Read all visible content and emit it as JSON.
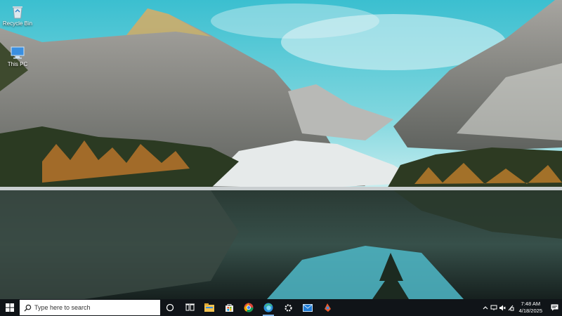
{
  "desktop": {
    "icons": [
      {
        "label": "Recycle Bin",
        "icon": "recycle-bin-icon"
      },
      {
        "label": "This PC",
        "icon": "this-pc-icon"
      }
    ]
  },
  "taskbar": {
    "search_placeholder": "Type here to search",
    "apps": [
      {
        "name": "cortana-icon"
      },
      {
        "name": "task-view-icon"
      },
      {
        "name": "file-explorer-icon"
      },
      {
        "name": "microsoft-store-icon"
      },
      {
        "name": "chrome-icon"
      },
      {
        "name": "edge-icon"
      },
      {
        "name": "settings-gear-icon"
      },
      {
        "name": "mail-icon"
      },
      {
        "name": "paint-icon"
      }
    ],
    "clock": {
      "time": "7:48 AM",
      "date": "4/18/2025"
    }
  },
  "colors": {
    "taskbar": "#101418",
    "accent": "#7fb2e5",
    "sky": "#45c6d6"
  }
}
